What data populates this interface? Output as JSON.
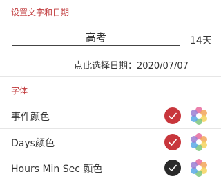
{
  "section_text_date": {
    "title": "设置文字和日期"
  },
  "event": {
    "name": "高考",
    "days": "14天"
  },
  "date_picker": {
    "label": "点此选择日期：2020/07/07"
  },
  "section_font": {
    "title": "字体"
  },
  "color_rows": [
    {
      "label": "事件颜色",
      "swatch_color": "#c8363c"
    },
    {
      "label": "Days颜色",
      "swatch_color": "#c8363c"
    },
    {
      "label": "Hours Min Sec 颜色",
      "swatch_color": "#2a2a2a"
    }
  ],
  "colors": {
    "accent": "#c0393b",
    "text": "#333333",
    "divider": "#e6e6e6"
  }
}
